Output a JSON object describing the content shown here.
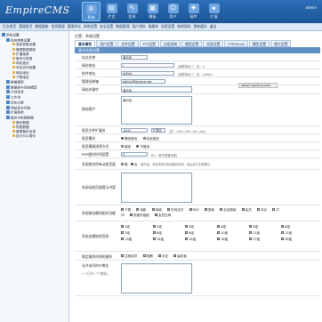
{
  "header": {
    "logo_main": "EmpireCMS",
    "logo_sub": "",
    "user_link": "admin"
  },
  "topnav": [
    {
      "label": "系统",
      "icon": "gear-icon"
    },
    {
      "label": "栏目",
      "icon": "folder-icon"
    },
    {
      "label": "信息",
      "icon": "document-icon"
    },
    {
      "label": "模板",
      "icon": "template-icon"
    },
    {
      "label": "用户",
      "icon": "user-icon"
    },
    {
      "label": "插件",
      "icon": "plugin-icon"
    },
    {
      "label": "扩展",
      "icon": "extend-icon"
    }
  ],
  "subnav": [
    "后台首页",
    "管理首页",
    "数据更新",
    "信息管理",
    "管理评论",
    "系统设置",
    "安全设置",
    "数据管理",
    "用户资料",
    "收藏夹",
    "标签设置",
    "修改密码",
    "更新缓存",
    "退出"
  ],
  "sidebar": [
    {
      "label": "系统设置",
      "level": 0
    },
    {
      "label": "系统参数设置",
      "level": 1
    },
    {
      "label": "系统参数设置",
      "level": 2
    },
    {
      "label": "管理数据更新",
      "level": 2
    },
    {
      "label": "扩展菜单",
      "level": 2
    },
    {
      "label": "备份与恢复",
      "level": 2
    },
    {
      "label": "网站首页",
      "level": 2
    },
    {
      "label": "安全访问设置",
      "level": 2
    },
    {
      "label": "网站地址",
      "level": 2
    },
    {
      "label": "下载地址",
      "level": 2
    },
    {
      "label": "数据更新",
      "level": 1
    },
    {
      "label": "数据表与系统模型",
      "level": 1
    },
    {
      "label": "计划任务",
      "level": 1
    },
    {
      "label": "工作流",
      "level": 1
    },
    {
      "label": "优化方案",
      "level": 1
    },
    {
      "label": "网站多访问端",
      "level": 1
    },
    {
      "label": "扩展菜单",
      "level": 1
    },
    {
      "label": "备份与恢复数据",
      "level": 1
    },
    {
      "label": "备份数据",
      "level": 2
    },
    {
      "label": "恢复数据",
      "level": 2
    },
    {
      "label": "管理备份目录",
      "level": 2
    },
    {
      "label": "执行SQL语句",
      "level": 2
    }
  ],
  "crumb": "位置：系统设置",
  "tabs": [
    "基本属性",
    "用户设置",
    "文件设置",
    "FTP设置",
    "分组系统",
    "模型设置",
    "信息设置",
    "FTP/Email",
    "模型设置",
    "图片设置"
  ],
  "section_title": "基本信息设置",
  "fields": {
    "site_name": {
      "label": "站点名称",
      "value": "演示站"
    },
    "site_url": {
      "label": "网站地址",
      "value": "/",
      "hint": "(结尾需加\"/\"，如：/)"
    },
    "app_path": {
      "label": "附件地址",
      "value": "/d/file/",
      "hint": "(结尾需加\"/\"，如：/d/file/)"
    },
    "admin_email": {
      "label": "管理员邮箱",
      "value": "admin@phome.net"
    },
    "keywords": {
      "label": "网站关键字",
      "value": "演示站"
    },
    "description": {
      "label": "网站简介",
      "value": "演示站"
    },
    "index_ext": {
      "label": "首页文件扩展名",
      "value": ".html",
      "select": "扩展名",
      "hint": "(如：.html,.htm,.xml,.php)"
    },
    "index_mode": {
      "label": "首页模式",
      "opt1": "静态首页",
      "opt2": "动态首页"
    },
    "sort_mode": {
      "label": "首页模板排序方式",
      "opt1": "增加",
      "opt2": "不增加"
    },
    "php_time": {
      "label": "PHP超时时间设置",
      "value": "0",
      "hint": "秒 (一般不需要设置)"
    },
    "close_site": {
      "label": "关闭前台所有动态页面",
      "opt1": "是",
      "opt2": "否",
      "hint": "(如开启，前台所有动态页面将关闭，但后台可正常操作)"
    },
    "close_tip": {
      "label": "关闭动态页面提示内容"
    },
    "close_modules": {
      "label": "关闭前台模块相关功能",
      "items": [
        "下载",
        "电影",
        "商城",
        "在线支付",
        "RSS",
        "搜索",
        "全站搜索",
        "会员",
        "评论",
        "打印",
        "关键字链接",
        "会员空间"
      ]
    },
    "user_groups": {
      "label": "开启自增加的页码",
      "items": [
        "1组",
        "2组",
        "3组",
        "4组",
        "5组",
        "6组",
        "7组",
        "8组",
        "9组",
        "10组",
        "11组",
        "12组",
        "13组",
        "14组",
        "15组",
        "16组",
        "17组",
        "18组"
      ]
    },
    "close_time": {
      "label": "限定操作时间的操作",
      "items": [
        "注册会员",
        "投稿",
        "评论",
        "留言板"
      ]
    },
    "allow_ips": {
      "label": "允许访问的IP地址",
      "hint": "(一行为一个地址)"
    }
  },
  "tooltip": "www.hupuduo.com"
}
